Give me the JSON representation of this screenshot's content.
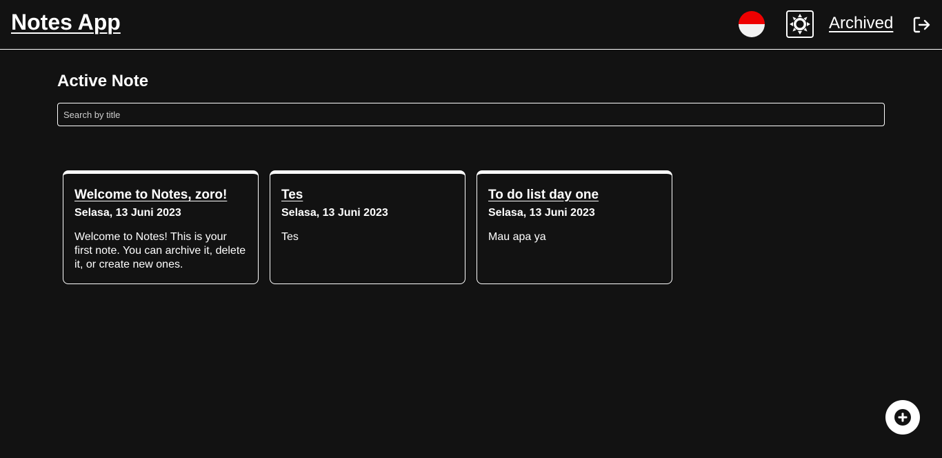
{
  "header": {
    "app_title": "Notes App",
    "locale_flag_colors": [
      "#ee0000",
      "#f2f2f2"
    ],
    "theme_icon": "sun-icon",
    "archived_label": "Archived",
    "logout_icon": "logout-icon"
  },
  "main": {
    "title": "Active Note",
    "search": {
      "placeholder": "Search by title",
      "value": ""
    },
    "notes": [
      {
        "title": "Welcome to Notes, zoro!",
        "date": "Selasa, 13 Juni 2023",
        "body": "Welcome to Notes! This is your first note. You can archive it, delete it, or create new ones."
      },
      {
        "title": "Tes",
        "date": "Selasa, 13 Juni 2023",
        "body": "Tes"
      },
      {
        "title": "To do list day one",
        "date": "Selasa, 13 Juni 2023",
        "body": "Mau apa ya"
      }
    ]
  },
  "fab": {
    "icon": "plus-circle-icon"
  },
  "colors": {
    "background": "#121212",
    "foreground": "#ffffff"
  }
}
